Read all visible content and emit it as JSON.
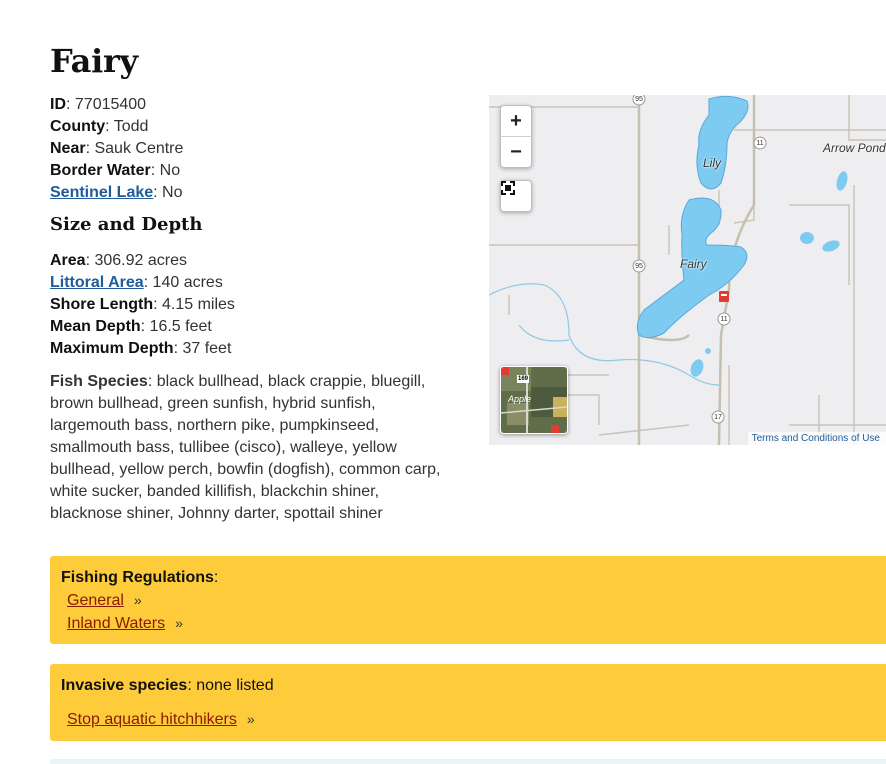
{
  "lake": {
    "name": "Fairy",
    "id_label": "ID",
    "id_value": ": 77015400",
    "county_label": "County",
    "county_value": ": Todd",
    "near_label": "Near",
    "near_value": ": Sauk Centre",
    "border_label": "Border Water",
    "border_value": ": No",
    "sentinel_label": "Sentinel Lake",
    "sentinel_value": ": No"
  },
  "size_depth": {
    "heading": "Size and Depth",
    "area_label": "Area",
    "area_value": ": 306.92 acres",
    "littoral_label": "Littoral Area",
    "littoral_value": ": 140 acres",
    "shore_label": "Shore Length",
    "shore_value": ": 4.15 miles",
    "mean_label": "Mean Depth",
    "mean_value": ": 16.5 feet",
    "max_label": "Maximum Depth",
    "max_value": ": 37 feet"
  },
  "fish": {
    "label": "Fish Species",
    "value": ": black bullhead, black crappie, bluegill, brown bullhead, green sunfish, hybrid sunfish, largemouth bass, northern pike, pumpkinseed, smallmouth bass, tullibee (cisco), walleye, yellow bullhead, yellow perch, bowfin (dogfish), common carp, white sucker, banded killifish, blackchin shiner, blacknose shiner, Johnny darter, spottail shiner"
  },
  "map": {
    "zoom_in": "+",
    "zoom_out": "−",
    "fullscreen_icon": "fullscreen-icon",
    "lake_labels": [
      "Fairy",
      "Lily",
      "Arrow Pond"
    ],
    "road_shields": [
      "95",
      "11",
      "95",
      "11",
      "17",
      "169"
    ],
    "inset_label": "Apple",
    "attribution": "Terms and Conditions of Use",
    "water_color": "#7ecbf2",
    "land_color": "#eeeef0"
  },
  "regulations": {
    "label": "Fishing Regulations",
    "suffix": ":",
    "links": [
      "General",
      "Inland Waters"
    ],
    "chevron": "»"
  },
  "invasive": {
    "label": "Invasive species",
    "value": ": none listed",
    "link": "Stop aquatic hitchhikers",
    "chevron": "»"
  },
  "colors": {
    "panel": "#fecc3b",
    "link": "#1f5c99",
    "reg_link": "#8a1a00"
  }
}
